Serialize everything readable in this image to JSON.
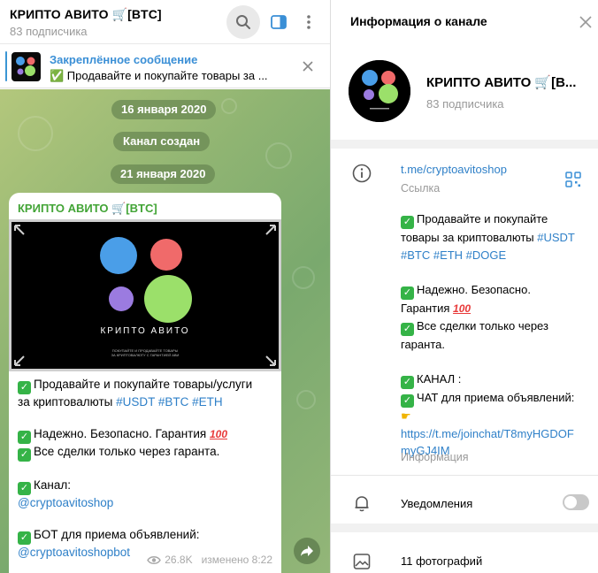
{
  "chat": {
    "title": "КРИПТО АВИТО 🛒[BTC]",
    "subscribers": "83 подписчика"
  },
  "pinned": {
    "label": "Закреплённое сообщение",
    "text": "✅ Продавайте и покупайте товары за ..."
  },
  "service": {
    "date1": "16 января 2020",
    "created": "Канал создан",
    "date2": "21 января 2020"
  },
  "message": {
    "sender": "КРИПТО АВИТО 🛒[BTC]",
    "media_title": "КРИПТО АВИТО",
    "media_caption_1": "ПОКУПАЙТЕ И ПРОДАВАЙТЕ ТОВАРЫ",
    "media_caption_2": "ЗА КРИПТОВАЛЮТУ С ГАРАНТИЕЙ АВИ",
    "line1": "Продавайте и покупайте товары/услуги",
    "line2_text": "за криптовалюты ",
    "line2_tags": "#USDT #BTC #ETH",
    "line3": "Надежно. Безопасно. Гарантия ",
    "line4": "Все сделки только через гаранта.",
    "line5": "Канал:",
    "line6": "@cryptoavitoshop",
    "line7": "БОТ для приема объявлений:",
    "line8": "@cryptoavitoshopbot",
    "hundred": "100",
    "views": "26.8K",
    "edited": "изменено 8:22"
  },
  "info": {
    "title": "Информация о канале",
    "name": "КРИПТО АВИТО 🛒[B...",
    "subscribers": "83 подписчика",
    "link": "t.me/cryptoavitoshop",
    "link_caption": "Ссылка",
    "desc1": "Продавайте и покупайте",
    "desc2_text": "товары за криптовалюты ",
    "desc2_tag": "#USDT",
    "desc3": "#BTC #ETH #DOGE",
    "desc4": "Надежно. Безопасно.",
    "desc5": "Гарантия ",
    "desc6": "Все сделки только через",
    "desc7": "гаранта.",
    "desc8": "КАНАЛ :",
    "desc9": "ЧАТ для приема объявлений:",
    "desc10": "https://t.me/joinchat/T8myHGDOF",
    "desc11": "myGJ4IM",
    "hundred": "100",
    "desc_caption": "Информация",
    "notifications": "Уведомления",
    "photos": "11 фотографий"
  },
  "colors": {
    "accent": "#3a8fd6",
    "sender": "#42a436",
    "check": "#35b347",
    "circle_blue": "#4a9ee8",
    "circle_red": "#f06a6a",
    "circle_purple": "#9b7be0",
    "circle_green": "#9be06a"
  },
  "icons": [
    "search-icon",
    "sidebar-toggle-icon",
    "more-vertical-icon",
    "close-icon",
    "info-icon",
    "qr-code-icon",
    "bell-icon",
    "image-icon",
    "eye-icon",
    "share-icon"
  ]
}
